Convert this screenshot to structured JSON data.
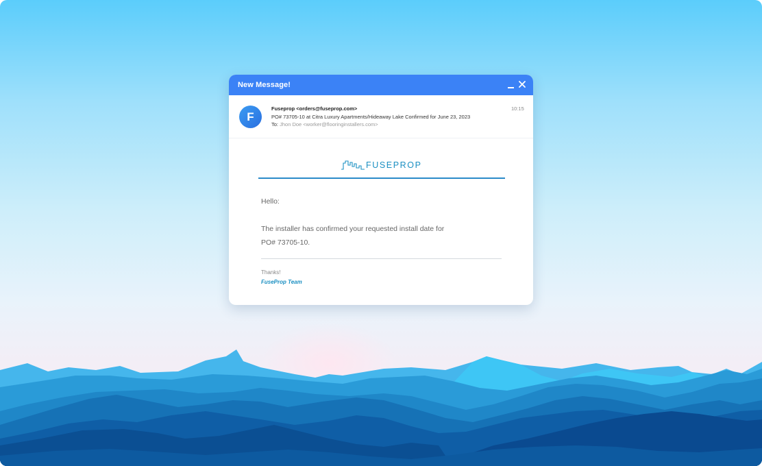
{
  "window": {
    "title": "New Message!",
    "minimize_icon": "minimize-icon",
    "close_icon": "close-icon"
  },
  "email": {
    "avatar_letter": "F",
    "from": "Fuseprop <orders@fuseprop.com>",
    "subject": "PO# 73705-10 at Citra Luxury Apartments/Hideaway Lake Confirmed for June 23, 2023",
    "to_label": "To:",
    "to_value": "Jhon Doe <worker@flooringinstallers.com>",
    "time": "10:15"
  },
  "body": {
    "logo_text": "FUSEPROP",
    "greeting": "Hello:",
    "message_line1": "The installer has confirmed your requested install date for",
    "message_line2": "PO# 73705-10.",
    "thanks": "Thanks!",
    "signature": "FuseProp Team"
  },
  "colors": {
    "titlebar": "#3b82f6",
    "accent": "#1a8fc2",
    "rule": "#2a8ac9"
  }
}
